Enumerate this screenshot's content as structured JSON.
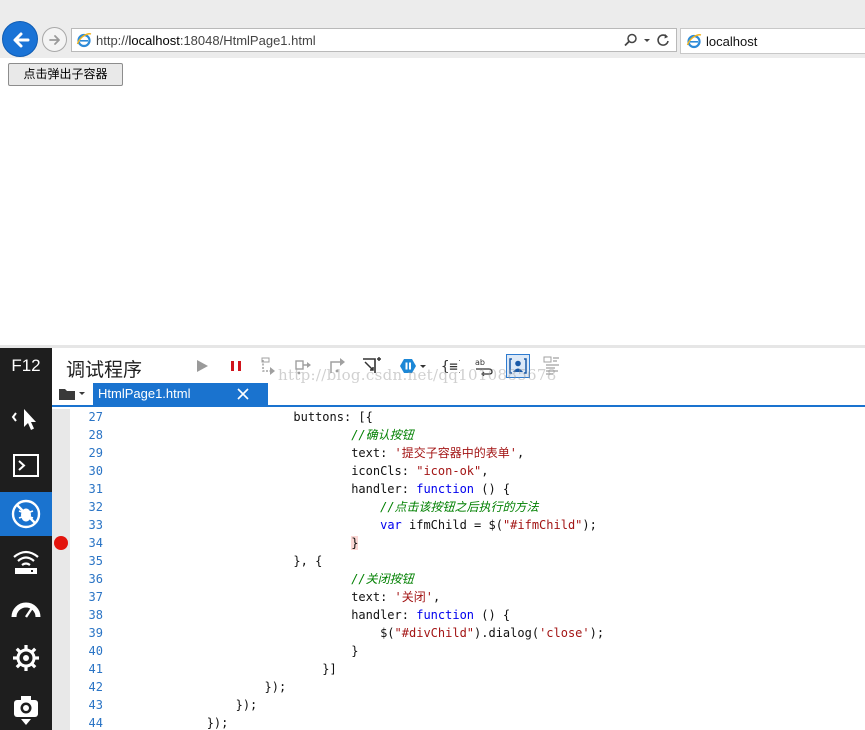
{
  "browser": {
    "url_prefix": "http://",
    "url_host": "localhost",
    "url_rest": ":18048/HtmlPage1.html",
    "tab_title": "localhost"
  },
  "page": {
    "popup_button_label": "点击弹出子容器"
  },
  "devtools": {
    "f12_label": "F12",
    "title": "调试程序",
    "watermark": "http://blog.csdn.net/qq1010885678",
    "file_tab": "HtmlPage1.html",
    "breakpoint_line": 34,
    "colors": {
      "accent": "#1a73cf",
      "breakpoint": "#e3140d",
      "keyword": "#0000ee",
      "string": "#a31515",
      "comment": "#008000",
      "line_number": "#2a74c5"
    },
    "sidebar_tools": [
      "dom-explorer-icon",
      "console-icon",
      "debugger-icon",
      "network-icon",
      "performance-icon",
      "memory-icon",
      "emulation-icon"
    ],
    "code_lines": [
      {
        "n": "27",
        "t": [
          [
            "",
            "                        buttons: [{"
          ]
        ]
      },
      {
        "n": "28",
        "t": [
          [
            "",
            "                                "
          ],
          [
            "com",
            "//确认按钮"
          ]
        ]
      },
      {
        "n": "29",
        "t": [
          [
            "",
            "                                text: "
          ],
          [
            "str",
            "'提交子容器中的表单'"
          ],
          [
            "",
            ","
          ]
        ]
      },
      {
        "n": "30",
        "t": [
          [
            "",
            "                                iconCls: "
          ],
          [
            "str",
            "\"icon-ok\""
          ],
          [
            "",
            ","
          ]
        ]
      },
      {
        "n": "31",
        "t": [
          [
            "",
            "                                handler: "
          ],
          [
            "kw",
            "function"
          ],
          [
            "",
            " () {"
          ]
        ]
      },
      {
        "n": "32",
        "t": [
          [
            "",
            "                                    "
          ],
          [
            "com",
            "//点击该按钮之后执行的方法"
          ]
        ]
      },
      {
        "n": "33",
        "t": [
          [
            "",
            "                                    "
          ],
          [
            "kw",
            "var"
          ],
          [
            "",
            " ifmChild = $("
          ],
          [
            "str",
            "\"#ifmChild\""
          ],
          [
            "",
            ");"
          ]
        ]
      },
      {
        "n": "34",
        "t": [
          [
            "",
            "                                "
          ],
          [
            "bp",
            "}"
          ]
        ]
      },
      {
        "n": "35",
        "t": [
          [
            "",
            "                        }, {"
          ]
        ]
      },
      {
        "n": "36",
        "t": [
          [
            "",
            "                                "
          ],
          [
            "com",
            "//关闭按钮"
          ]
        ]
      },
      {
        "n": "37",
        "t": [
          [
            "",
            "                                text: "
          ],
          [
            "str",
            "'关闭'"
          ],
          [
            "",
            ","
          ]
        ]
      },
      {
        "n": "38",
        "t": [
          [
            "",
            "                                handler: "
          ],
          [
            "kw",
            "function"
          ],
          [
            "",
            " () {"
          ]
        ]
      },
      {
        "n": "39",
        "t": [
          [
            "",
            "                                    $("
          ],
          [
            "str",
            "\"#divChild\""
          ],
          [
            "",
            ").dialog("
          ],
          [
            "str",
            "'close'"
          ],
          [
            "",
            ");"
          ]
        ]
      },
      {
        "n": "40",
        "t": [
          [
            "",
            "                                }"
          ]
        ]
      },
      {
        "n": "41",
        "t": [
          [
            "",
            "                            }]"
          ]
        ]
      },
      {
        "n": "42",
        "t": [
          [
            "",
            "                    });"
          ]
        ]
      },
      {
        "n": "43",
        "t": [
          [
            "",
            "                });"
          ]
        ]
      },
      {
        "n": "44",
        "t": [
          [
            "",
            "            });"
          ]
        ]
      }
    ]
  }
}
